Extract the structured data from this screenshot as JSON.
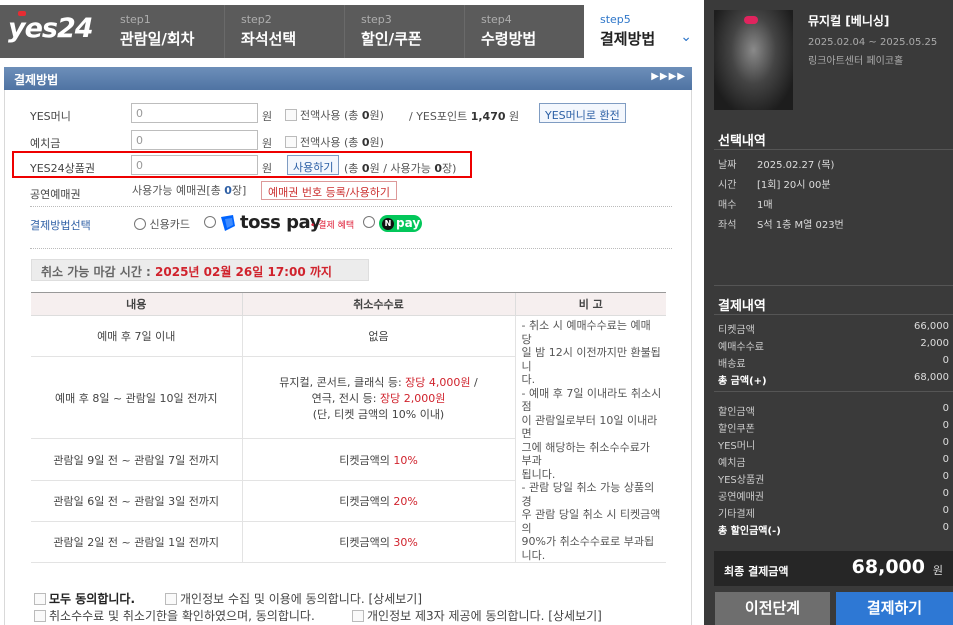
{
  "brand": {
    "logo": "yes24"
  },
  "steps": [
    {
      "num": "step1",
      "label": "관람일/회차"
    },
    {
      "num": "step2",
      "label": "좌석선택"
    },
    {
      "num": "step3",
      "label": "할인/쿠폰"
    },
    {
      "num": "step4",
      "label": "수령방법"
    },
    {
      "num": "step5",
      "label": "결제방법"
    }
  ],
  "section": {
    "title": "결제방법"
  },
  "form": {
    "yes_money": {
      "label": "YES머니",
      "value": "0",
      "unit": "원",
      "use_all": "전액사용 (총 ",
      "use_all_amount": "0",
      "use_all_unit": "원)",
      "point_prefix": "/ YES포인트",
      "point_value": "1,470",
      "point_unit": "원",
      "convert_button": "YES머니로 환전"
    },
    "deposit": {
      "label": "예치금",
      "value": "0",
      "unit": "원",
      "use_all": "전액사용 (총 ",
      "use_all_amount": "0",
      "use_all_unit": "원)"
    },
    "gift_card": {
      "label": "YES24상품권",
      "value": "0",
      "unit": "원",
      "use_button": "사용하기",
      "info_prefix": "(총 ",
      "info_total": "0",
      "info_mid": "원 / 사용가능 ",
      "info_count": "0",
      "info_suffix": "장)"
    },
    "voucher": {
      "label": "공연예매권",
      "info_prefix": "사용가능 예매권[총 ",
      "info_count": "0",
      "info_suffix": "장]",
      "register_button": "예매권 번호 등록/사용하기"
    },
    "method": {
      "label": "결제방법선택",
      "option_card": "신용카드",
      "toss_text": "toss pay",
      "toss_badge": "• 결제 혜택",
      "npay_text": "pay",
      "npay_n": "N"
    }
  },
  "deadline": {
    "prefix": "취소 가능 마감 시간 : ",
    "datetime": "2025년 02월 26일 17:00 까지"
  },
  "cancel_table": {
    "headers": [
      "내용",
      "취소수수료",
      "비 고"
    ],
    "rows": [
      {
        "period": "예매 후 7일 이내",
        "fee": "없음"
      },
      {
        "period": "예매 후 8일 ~ 관람일 10일 전까지",
        "fee_line1_prefix": "뮤지컬, 콘서트, 클래식 등: ",
        "fee_line1_red": "장당 4,000원",
        "fee_line1_suffix": " /",
        "fee_line2_prefix": "연극, 전시 등: ",
        "fee_line2_red": "장당 2,000원",
        "fee_line3": "(단, 티켓 금액의 10% 이내)"
      },
      {
        "period": "관람일 9일 전 ~ 관람일 7일 전까지",
        "fee_prefix": "티켓금액의 ",
        "fee_red": "10%"
      },
      {
        "period": "관람일 6일 전 ~ 관람일 3일 전까지",
        "fee_prefix": "티켓금액의 ",
        "fee_red": "20%"
      },
      {
        "period": "관람일 2일 전 ~ 관람일 1일 전까지",
        "fee_prefix": "티켓금액의 ",
        "fee_red": "30%"
      }
    ],
    "note_lines": [
      "- 취소 시 예매수수료는 예매 당",
      "일 밤 12시 이전까지만 환불됩니",
      "다.",
      "- 예매 후 7일 이내라도 취소시점",
      "이 관람일로부터 10일 이내라면",
      "그에 해당하는 취소수수료가 부과",
      "됩니다.",
      "- 관람 당일 취소 가능 상품의 경",
      "우 관람 당일 취소 시 티켓금액의",
      "90%가 취소수수료로 부과됩니다."
    ]
  },
  "agreements": {
    "all": "모두 동의합니다.",
    "privacy_collect": "개인정보 수집 및 이용에 동의합니다. [상세보기]",
    "cancel_fee": "취소수수료 및 취소기한을 확인하였으며, 동의합니다.",
    "privacy_third": "개인정보 제3자 제공에 동의합니다. [상세보기]"
  },
  "show": {
    "title": "뮤지컬 [베니싱]",
    "date_range": "2025.02.04 ~ 2025.05.25",
    "venue": "링크아트센터 페이코홀"
  },
  "selection": {
    "title": "선택내역",
    "items": [
      {
        "key": "날짜",
        "value": "2025.02.27 (목)"
      },
      {
        "key": "시간",
        "value": "[1회] 20시 00분"
      },
      {
        "key": "매수",
        "value": "1매"
      },
      {
        "key": "좌석",
        "value": "S석 1층 M열 023번"
      }
    ]
  },
  "payment": {
    "title": "결제내역",
    "items": [
      {
        "key": "티켓금액",
        "value": "66,000"
      },
      {
        "key": "예매수수료",
        "value": "2,000"
      },
      {
        "key": "배송료",
        "value": "0"
      },
      {
        "key": "총 금액(+)",
        "value": "68,000"
      }
    ],
    "discounts": [
      {
        "key": "할인금액",
        "value": "0"
      },
      {
        "key": "할인쿠폰",
        "value": "0"
      },
      {
        "key": "YES머니",
        "value": "0"
      },
      {
        "key": "예치금",
        "value": "0"
      },
      {
        "key": "YES상품권",
        "value": "0"
      },
      {
        "key": "공연예매권",
        "value": "0"
      },
      {
        "key": "기타결제",
        "value": "0"
      },
      {
        "key": "총 할인금액(-)",
        "value": "0"
      }
    ],
    "final_label": "최종 결제금액",
    "final_amount": "68,000",
    "final_unit": "원"
  },
  "buttons": {
    "prev": "이전단계",
    "pay": "결제하기"
  },
  "colors": {
    "accent": "#2e78d4",
    "highlight": "#ee0000",
    "panel": "#3a3a3a"
  }
}
